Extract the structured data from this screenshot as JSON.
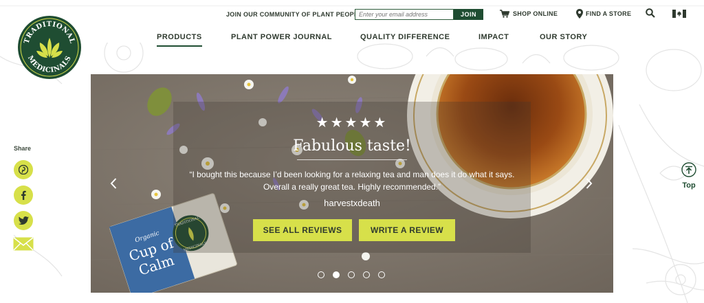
{
  "header": {
    "join_text": "JOIN OUR COMMUNITY OF PLANT PEOPLE",
    "email_placeholder": "Enter your email address",
    "join_label": "JOIN",
    "shop_online": "SHOP ONLINE",
    "find_store": "FIND A STORE"
  },
  "logo": {
    "text_top": "TRADITIONAL",
    "text_bottom": "MEDICINALS"
  },
  "nav": {
    "items": [
      {
        "label": "PRODUCTS",
        "active": true
      },
      {
        "label": "PLANT POWER JOURNAL",
        "active": false
      },
      {
        "label": "QUALITY DIFFERENCE",
        "active": false
      },
      {
        "label": "IMPACT",
        "active": false
      },
      {
        "label": "OUR STORY",
        "active": false
      }
    ]
  },
  "share": {
    "label": "Share",
    "icons": [
      "pinterest-icon",
      "facebook-icon",
      "twitter-icon",
      "email-icon"
    ]
  },
  "top_button": {
    "label": "Top"
  },
  "hero": {
    "stars": "★★★★★",
    "rating": 5,
    "title": "Fabulous taste!",
    "quote": "“I bought this because I’d been looking for a relaxing tea and man does it do what it says. Overall a really great tea. Highly recommended.”",
    "author": "harvestxdeath",
    "see_all": "SEE ALL REVIEWS",
    "write": "WRITE A REVIEW",
    "slides": 5,
    "active_slide": 2,
    "package": {
      "brand_top": "TRADITIONAL",
      "brand_bottom": "MEDICINALS",
      "organic": "Organic",
      "name_line1": "Cup of",
      "name_line2": "Calm"
    }
  },
  "colors": {
    "brand_green": "#1f4d32",
    "accent_yellow": "#d7e04a"
  }
}
